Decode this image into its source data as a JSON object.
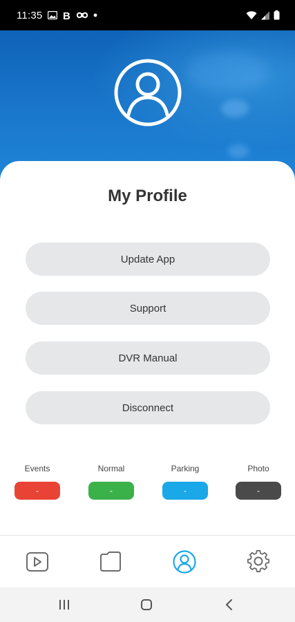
{
  "status_bar": {
    "time": "11:35",
    "left_icons": [
      "gallery-icon",
      "b-app-icon",
      "abc-icon",
      "dot-icon"
    ],
    "right_icons": [
      "wifi-icon",
      "signal-icon",
      "battery-icon"
    ]
  },
  "profile": {
    "title": "My Profile",
    "avatar_icon": "user-avatar-icon"
  },
  "menu": [
    {
      "label": "Update App"
    },
    {
      "label": "Support"
    },
    {
      "label": "DVR Manual"
    },
    {
      "label": "Disconnect"
    }
  ],
  "stats": [
    {
      "label": "Events",
      "value": "-",
      "color": "#e94335"
    },
    {
      "label": "Normal",
      "value": "-",
      "color": "#3bb14a"
    },
    {
      "label": "Parking",
      "value": "-",
      "color": "#1aa8e8"
    },
    {
      "label": "Photo",
      "value": "-",
      "color": "#4a4a4a"
    }
  ],
  "tabbar": {
    "tabs": [
      {
        "icon": "video-play-icon",
        "active": false
      },
      {
        "icon": "folder-icon",
        "active": false
      },
      {
        "icon": "profile-icon",
        "active": true
      },
      {
        "icon": "gear-icon",
        "active": false
      }
    ],
    "active_color": "#1aa8e8",
    "inactive_color": "#6b6b6b"
  },
  "nav_bar": {
    "buttons": [
      "recents-icon",
      "home-icon",
      "back-icon"
    ]
  }
}
